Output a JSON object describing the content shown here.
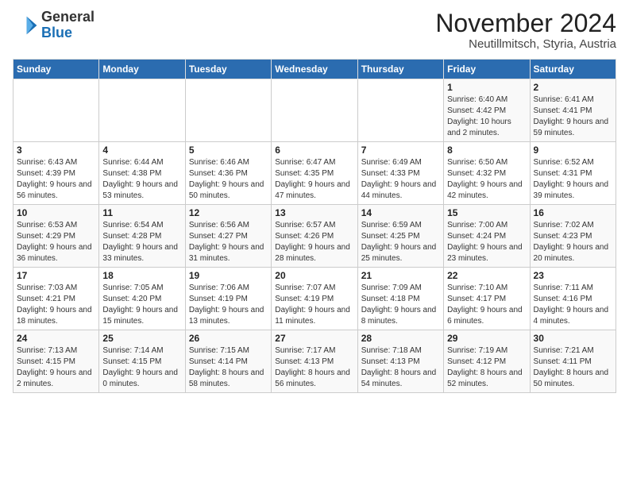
{
  "logo": {
    "general": "General",
    "blue": "Blue"
  },
  "header": {
    "month_title": "November 2024",
    "location": "Neutillmitsch, Styria, Austria"
  },
  "weekdays": [
    "Sunday",
    "Monday",
    "Tuesday",
    "Wednesday",
    "Thursday",
    "Friday",
    "Saturday"
  ],
  "weeks": [
    [
      {
        "day": "",
        "info": ""
      },
      {
        "day": "",
        "info": ""
      },
      {
        "day": "",
        "info": ""
      },
      {
        "day": "",
        "info": ""
      },
      {
        "day": "",
        "info": ""
      },
      {
        "day": "1",
        "info": "Sunrise: 6:40 AM\nSunset: 4:42 PM\nDaylight: 10 hours and 2 minutes."
      },
      {
        "day": "2",
        "info": "Sunrise: 6:41 AM\nSunset: 4:41 PM\nDaylight: 9 hours and 59 minutes."
      }
    ],
    [
      {
        "day": "3",
        "info": "Sunrise: 6:43 AM\nSunset: 4:39 PM\nDaylight: 9 hours and 56 minutes."
      },
      {
        "day": "4",
        "info": "Sunrise: 6:44 AM\nSunset: 4:38 PM\nDaylight: 9 hours and 53 minutes."
      },
      {
        "day": "5",
        "info": "Sunrise: 6:46 AM\nSunset: 4:36 PM\nDaylight: 9 hours and 50 minutes."
      },
      {
        "day": "6",
        "info": "Sunrise: 6:47 AM\nSunset: 4:35 PM\nDaylight: 9 hours and 47 minutes."
      },
      {
        "day": "7",
        "info": "Sunrise: 6:49 AM\nSunset: 4:33 PM\nDaylight: 9 hours and 44 minutes."
      },
      {
        "day": "8",
        "info": "Sunrise: 6:50 AM\nSunset: 4:32 PM\nDaylight: 9 hours and 42 minutes."
      },
      {
        "day": "9",
        "info": "Sunrise: 6:52 AM\nSunset: 4:31 PM\nDaylight: 9 hours and 39 minutes."
      }
    ],
    [
      {
        "day": "10",
        "info": "Sunrise: 6:53 AM\nSunset: 4:29 PM\nDaylight: 9 hours and 36 minutes."
      },
      {
        "day": "11",
        "info": "Sunrise: 6:54 AM\nSunset: 4:28 PM\nDaylight: 9 hours and 33 minutes."
      },
      {
        "day": "12",
        "info": "Sunrise: 6:56 AM\nSunset: 4:27 PM\nDaylight: 9 hours and 31 minutes."
      },
      {
        "day": "13",
        "info": "Sunrise: 6:57 AM\nSunset: 4:26 PM\nDaylight: 9 hours and 28 minutes."
      },
      {
        "day": "14",
        "info": "Sunrise: 6:59 AM\nSunset: 4:25 PM\nDaylight: 9 hours and 25 minutes."
      },
      {
        "day": "15",
        "info": "Sunrise: 7:00 AM\nSunset: 4:24 PM\nDaylight: 9 hours and 23 minutes."
      },
      {
        "day": "16",
        "info": "Sunrise: 7:02 AM\nSunset: 4:23 PM\nDaylight: 9 hours and 20 minutes."
      }
    ],
    [
      {
        "day": "17",
        "info": "Sunrise: 7:03 AM\nSunset: 4:21 PM\nDaylight: 9 hours and 18 minutes."
      },
      {
        "day": "18",
        "info": "Sunrise: 7:05 AM\nSunset: 4:20 PM\nDaylight: 9 hours and 15 minutes."
      },
      {
        "day": "19",
        "info": "Sunrise: 7:06 AM\nSunset: 4:19 PM\nDaylight: 9 hours and 13 minutes."
      },
      {
        "day": "20",
        "info": "Sunrise: 7:07 AM\nSunset: 4:19 PM\nDaylight: 9 hours and 11 minutes."
      },
      {
        "day": "21",
        "info": "Sunrise: 7:09 AM\nSunset: 4:18 PM\nDaylight: 9 hours and 8 minutes."
      },
      {
        "day": "22",
        "info": "Sunrise: 7:10 AM\nSunset: 4:17 PM\nDaylight: 9 hours and 6 minutes."
      },
      {
        "day": "23",
        "info": "Sunrise: 7:11 AM\nSunset: 4:16 PM\nDaylight: 9 hours and 4 minutes."
      }
    ],
    [
      {
        "day": "24",
        "info": "Sunrise: 7:13 AM\nSunset: 4:15 PM\nDaylight: 9 hours and 2 minutes."
      },
      {
        "day": "25",
        "info": "Sunrise: 7:14 AM\nSunset: 4:15 PM\nDaylight: 9 hours and 0 minutes."
      },
      {
        "day": "26",
        "info": "Sunrise: 7:15 AM\nSunset: 4:14 PM\nDaylight: 8 hours and 58 minutes."
      },
      {
        "day": "27",
        "info": "Sunrise: 7:17 AM\nSunset: 4:13 PM\nDaylight: 8 hours and 56 minutes."
      },
      {
        "day": "28",
        "info": "Sunrise: 7:18 AM\nSunset: 4:13 PM\nDaylight: 8 hours and 54 minutes."
      },
      {
        "day": "29",
        "info": "Sunrise: 7:19 AM\nSunset: 4:12 PM\nDaylight: 8 hours and 52 minutes."
      },
      {
        "day": "30",
        "info": "Sunrise: 7:21 AM\nSunset: 4:11 PM\nDaylight: 8 hours and 50 minutes."
      }
    ]
  ]
}
